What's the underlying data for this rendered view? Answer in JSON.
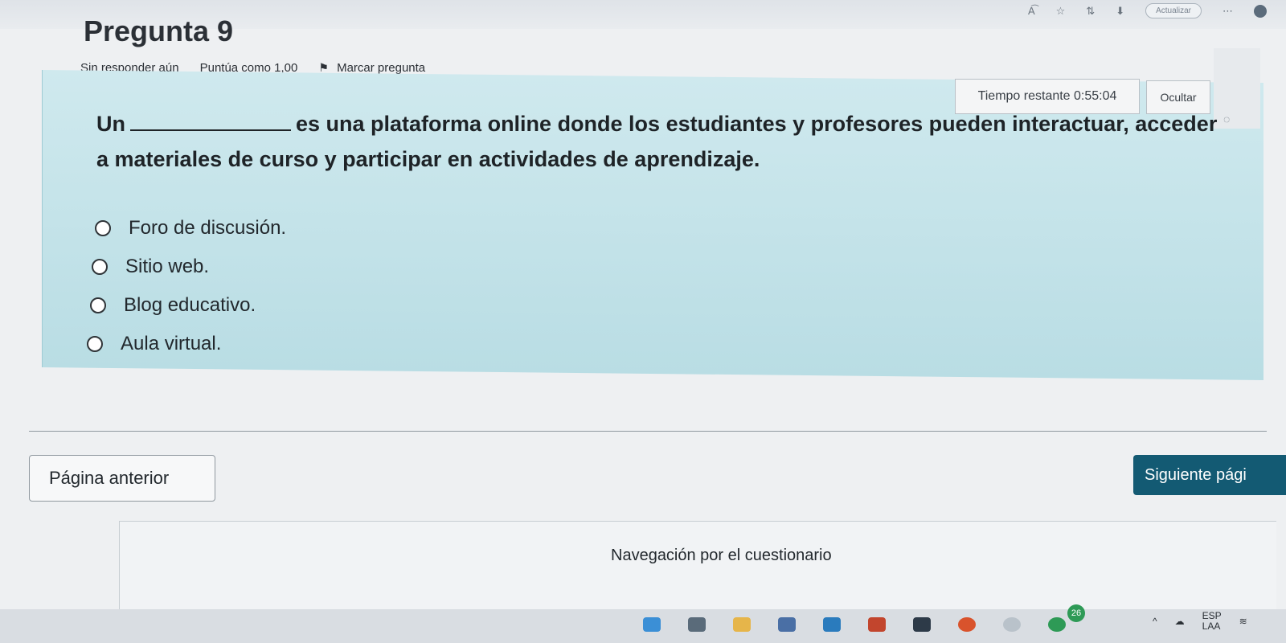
{
  "browser": {
    "update_label": "Actualizar",
    "icons": [
      "text-size-icon",
      "favorite-icon",
      "extension-icon",
      "download-icon",
      "profile-icon"
    ]
  },
  "question": {
    "title": "Pregunta 9",
    "status": "Sin responder aún",
    "score": "Puntúa como 1,00",
    "flag_label": "Marcar pregunta",
    "text_start": "Un",
    "text_rest": "es una plataforma online donde los estudiantes y profesores pueden interactuar, acceder a materiales de curso y participar en actividades de aprendizaje.",
    "options": [
      "Foro de discusión.",
      "Sitio web.",
      "Blog educativo.",
      "Aula virtual."
    ]
  },
  "timer": {
    "label": "Tiempo restante",
    "value": "0:55:04",
    "hide_label": "Ocultar"
  },
  "navigation": {
    "prev_label": "Página anterior",
    "next_label": "Siguiente pági",
    "quiz_nav_title": "Navegación por el cuestionario"
  },
  "taskbar": {
    "badge": "26",
    "lang": "ESP",
    "layout": "LAA"
  },
  "colors": {
    "card_bg": "#c3e3e9",
    "next_button": "#135a73",
    "text": "#1d2125"
  }
}
